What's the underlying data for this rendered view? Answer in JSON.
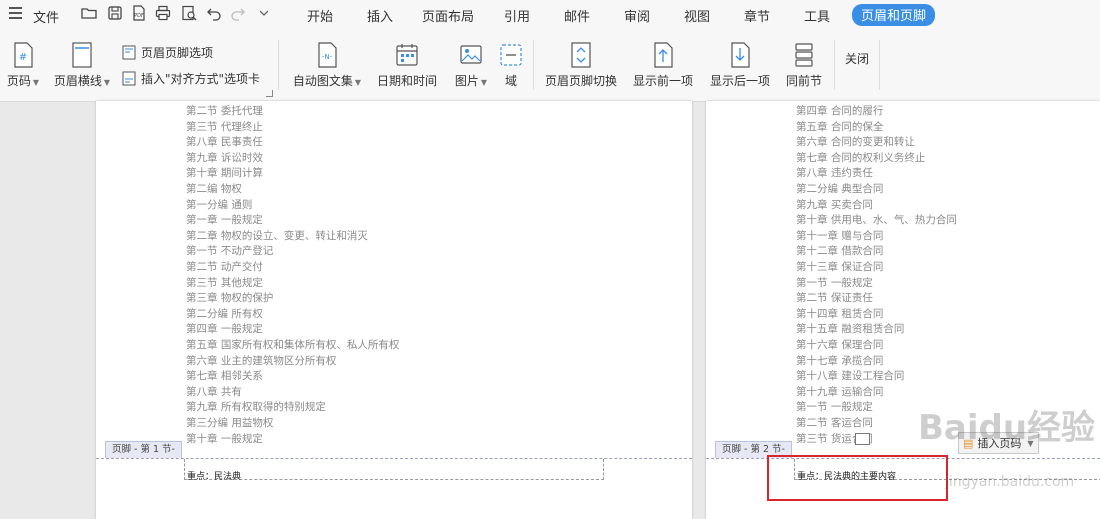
{
  "menubar": {
    "file_label": "文件",
    "quick_access_icons": [
      "open-folder-icon",
      "save-icon",
      "export-pdf-icon",
      "print-icon",
      "print-preview-icon",
      "undo-icon",
      "redo-icon",
      "customize-dropdown-icon"
    ],
    "pdf_glyph": "PDF",
    "tabs": [
      {
        "label": "开始",
        "active": false
      },
      {
        "label": "插入",
        "active": false
      },
      {
        "label": "页面布局",
        "active": false
      },
      {
        "label": "引用",
        "active": false
      },
      {
        "label": "邮件",
        "active": false
      },
      {
        "label": "审阅",
        "active": false
      },
      {
        "label": "视图",
        "active": false
      },
      {
        "label": "章节",
        "active": false
      },
      {
        "label": "工具",
        "active": false
      },
      {
        "label": "页眉和页脚",
        "active": true
      }
    ],
    "active_color": "#3a8ee6"
  },
  "ribbon": {
    "page_number": "页码",
    "header_line": "页眉横线",
    "header_footer_options": "页眉页脚选项",
    "insert_align_tab": "插入\"对齐方式\"选项卡",
    "auto_text": "自动图文集",
    "date_time": "日期和时间",
    "picture": "图片",
    "field": "域",
    "hf_switch": "页眉页脚切换",
    "show_prev": "显示前一项",
    "show_next": "显示后一项",
    "same_as_prev": "同前节",
    "close": "关闭",
    "glyphs": {
      "page_number_icon": "#",
      "auto_text_icon": "-N-"
    }
  },
  "page1": {
    "toc": [
      "第二节  委托代理",
      "第三节  代理终止",
      "第八章  民事责任",
      "第九章  诉讼时效",
      "第十章  期间计算",
      "第二编  物权",
      "第一分编  通则",
      "第一章  一般规定",
      "第二章  物权的设立、变更、转让和消灭",
      "第一节  不动产登记",
      "第二节  动产交付",
      "第三节  其他规定",
      "第三章  物权的保护",
      "第二分编  所有权",
      "第四章  一般规定",
      "第五章  国家所有权和集体所有权、私人所有权",
      "第六章  业主的建筑物区分所有权",
      "第七章  相邻关系",
      "第八章  共有",
      "第九章  所有权取得的特别规定",
      "第三分编  用益物权",
      "第十章  一般规定"
    ],
    "footer_tag": "页脚 - 第 1 节-",
    "footer_text": "重点：民法典"
  },
  "page2": {
    "toc": [
      "第四章  合同的履行",
      "第五章  合同的保全",
      "第六章  合同的变更和转让",
      "第七章  合同的权利义务终止",
      "第八章  违约责任",
      "第二分编  典型合同",
      "第九章  买卖合同",
      "第十章  供用电、水、气、热力合同",
      "第十一章  赠与合同",
      "第十二章  借款合同",
      "第十三章  保证合同",
      "第一节  一般规定",
      "第二节  保证责任",
      "第十四章  租赁合同",
      "第十五章  融资租赁合同",
      "第十六章  保理合同",
      "第十七章  承揽合同",
      "第十八章  建设工程合同",
      "第十九章  运输合同",
      "第一节  一般规定",
      "第二节  客运合同",
      "第三节  货运合同"
    ],
    "footer_tag": "页脚 - 第 2 节-",
    "footer_text": "重点：民法典的主要内容",
    "insert_tab_button": "插入页码",
    "highlight_color": "#d9262c"
  },
  "watermark": {
    "main": "Baidu经验",
    "sub": "jingyan.baidu.com"
  }
}
